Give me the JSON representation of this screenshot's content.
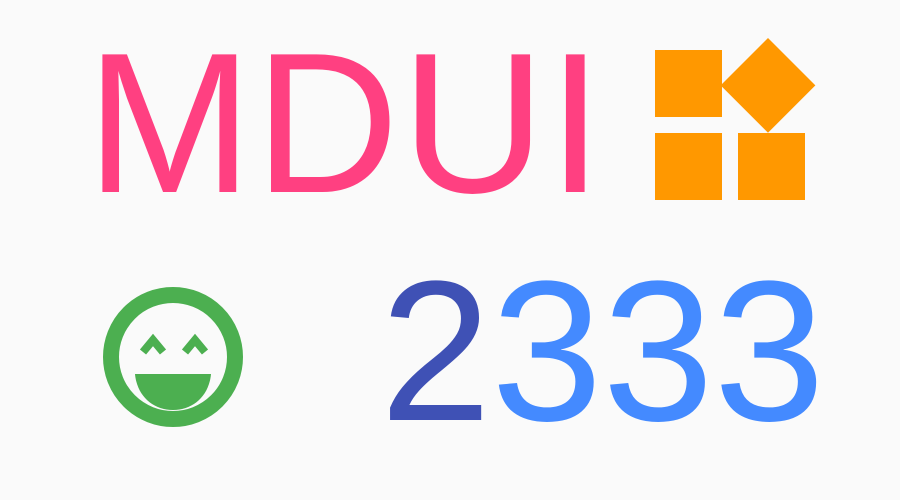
{
  "brand": {
    "title": "MDUI",
    "title_color": "#ff4081"
  },
  "logo_icon": {
    "name": "mdui-logo-icon",
    "color": "#ff9800"
  },
  "smile_icon": {
    "name": "smiley-face-icon",
    "color": "#4caf50"
  },
  "number": {
    "first_digit": "2",
    "rest_digits": "333",
    "first_color": "#3f51b5",
    "rest_color": "#448aff"
  }
}
